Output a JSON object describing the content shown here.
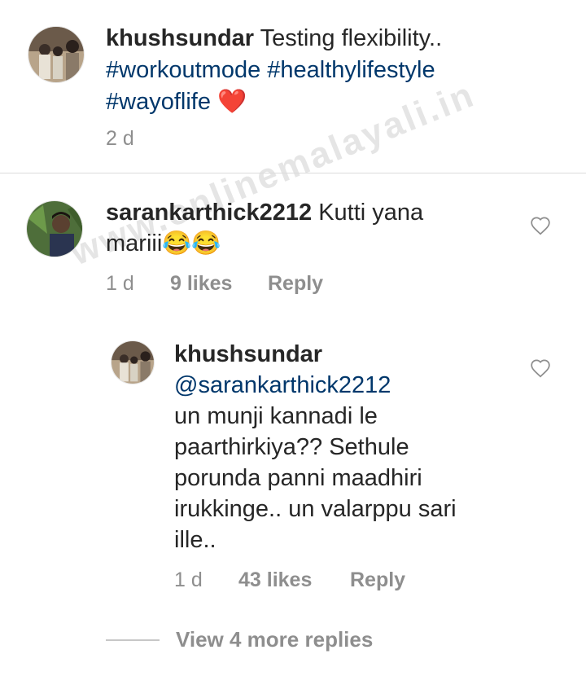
{
  "post": {
    "username": "khushsundar",
    "caption_text": "Testing flexibility..",
    "hashtags": [
      "#workoutmode",
      "#healthylifestyle",
      "#wayoflife"
    ],
    "emoji": "❤️",
    "age": "2 d"
  },
  "comment": {
    "username": "sarankarthick2212",
    "text": "Kutti yana mariii😂😂",
    "age": "1 d",
    "likes": "9 likes",
    "reply_label": "Reply"
  },
  "reply": {
    "username": "khushsundar",
    "mention": "@sarankarthick2212",
    "text": "un munji kannadi le paarthirkiya?? Sethule porunda panni maadhiri irukkinge.. un valarppu sari ille..",
    "age": "1 d",
    "likes": "43 likes",
    "reply_label": "Reply"
  },
  "view_more": "View 4 more replies",
  "watermark": "www.onlinemalayali.in",
  "colors": {
    "link": "#00376b",
    "muted": "#8e8e8e",
    "text": "#262626",
    "heart": "#e0245e"
  }
}
